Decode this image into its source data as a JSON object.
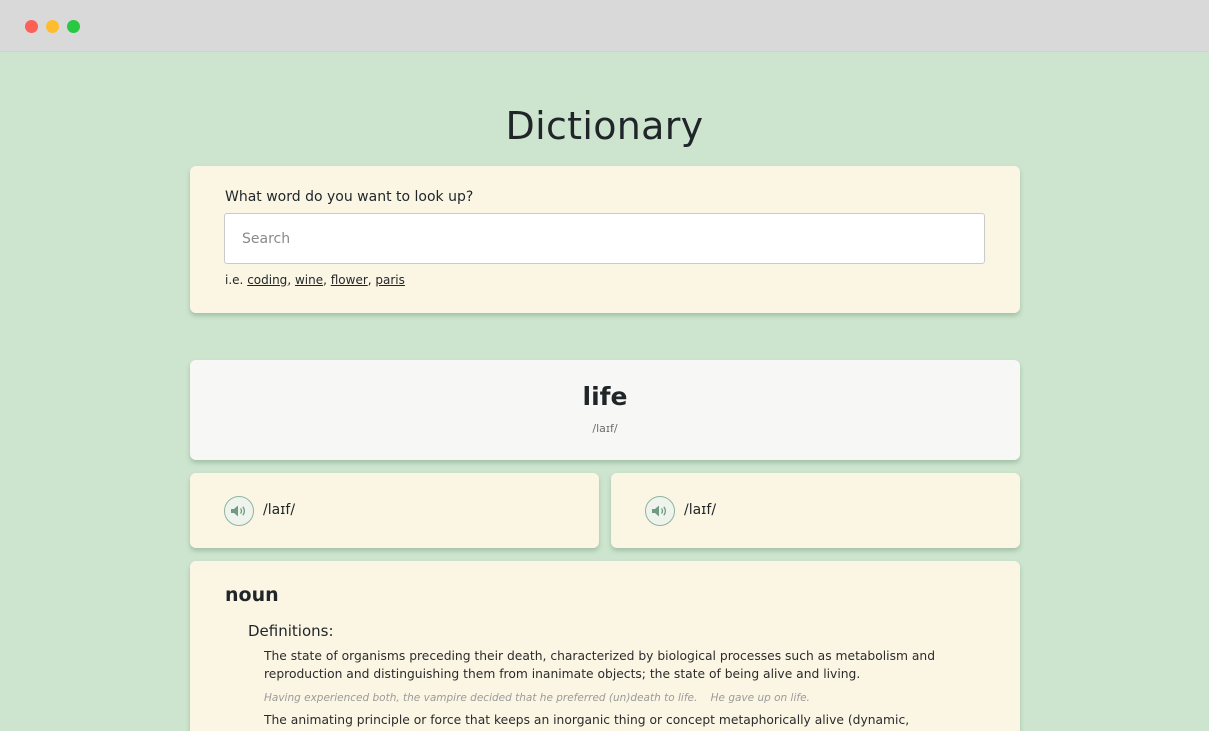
{
  "app": {
    "title": "Dictionary"
  },
  "search": {
    "question": "What word do you want to look up?",
    "placeholder": "Search",
    "value": "",
    "examples_prefix": "i.e.",
    "examples": [
      "coding",
      "wine",
      "flower",
      "paris"
    ]
  },
  "result": {
    "word": "life",
    "phonetic": "/laɪf/",
    "phonetics": [
      {
        "text": "/laɪf/",
        "icon": "speaker-icon"
      },
      {
        "text": "/laɪf/",
        "icon": "speaker-icon"
      }
    ],
    "meanings": [
      {
        "part_of_speech": "noun",
        "definitions_heading": "Definitions:",
        "definitions": [
          {
            "definition": "The state of organisms preceding their death, characterized by biological processes such as metabolism and reproduction and distinguishing them from inanimate objects; the state of being alive and living.",
            "example": "Having experienced both, the vampire decided that he preferred (un)death to life.    He gave up on life."
          },
          {
            "definition": "The animating principle or force that keeps an inorganic thing or concept metaphorically alive (dynamic, relevant,"
          }
        ]
      }
    ]
  },
  "colors": {
    "background": "#cde5cf",
    "card": "#fbf6e4",
    "word_card": "#f7f8f5",
    "text": "#1f2528",
    "accent": "#8fb3a0"
  }
}
